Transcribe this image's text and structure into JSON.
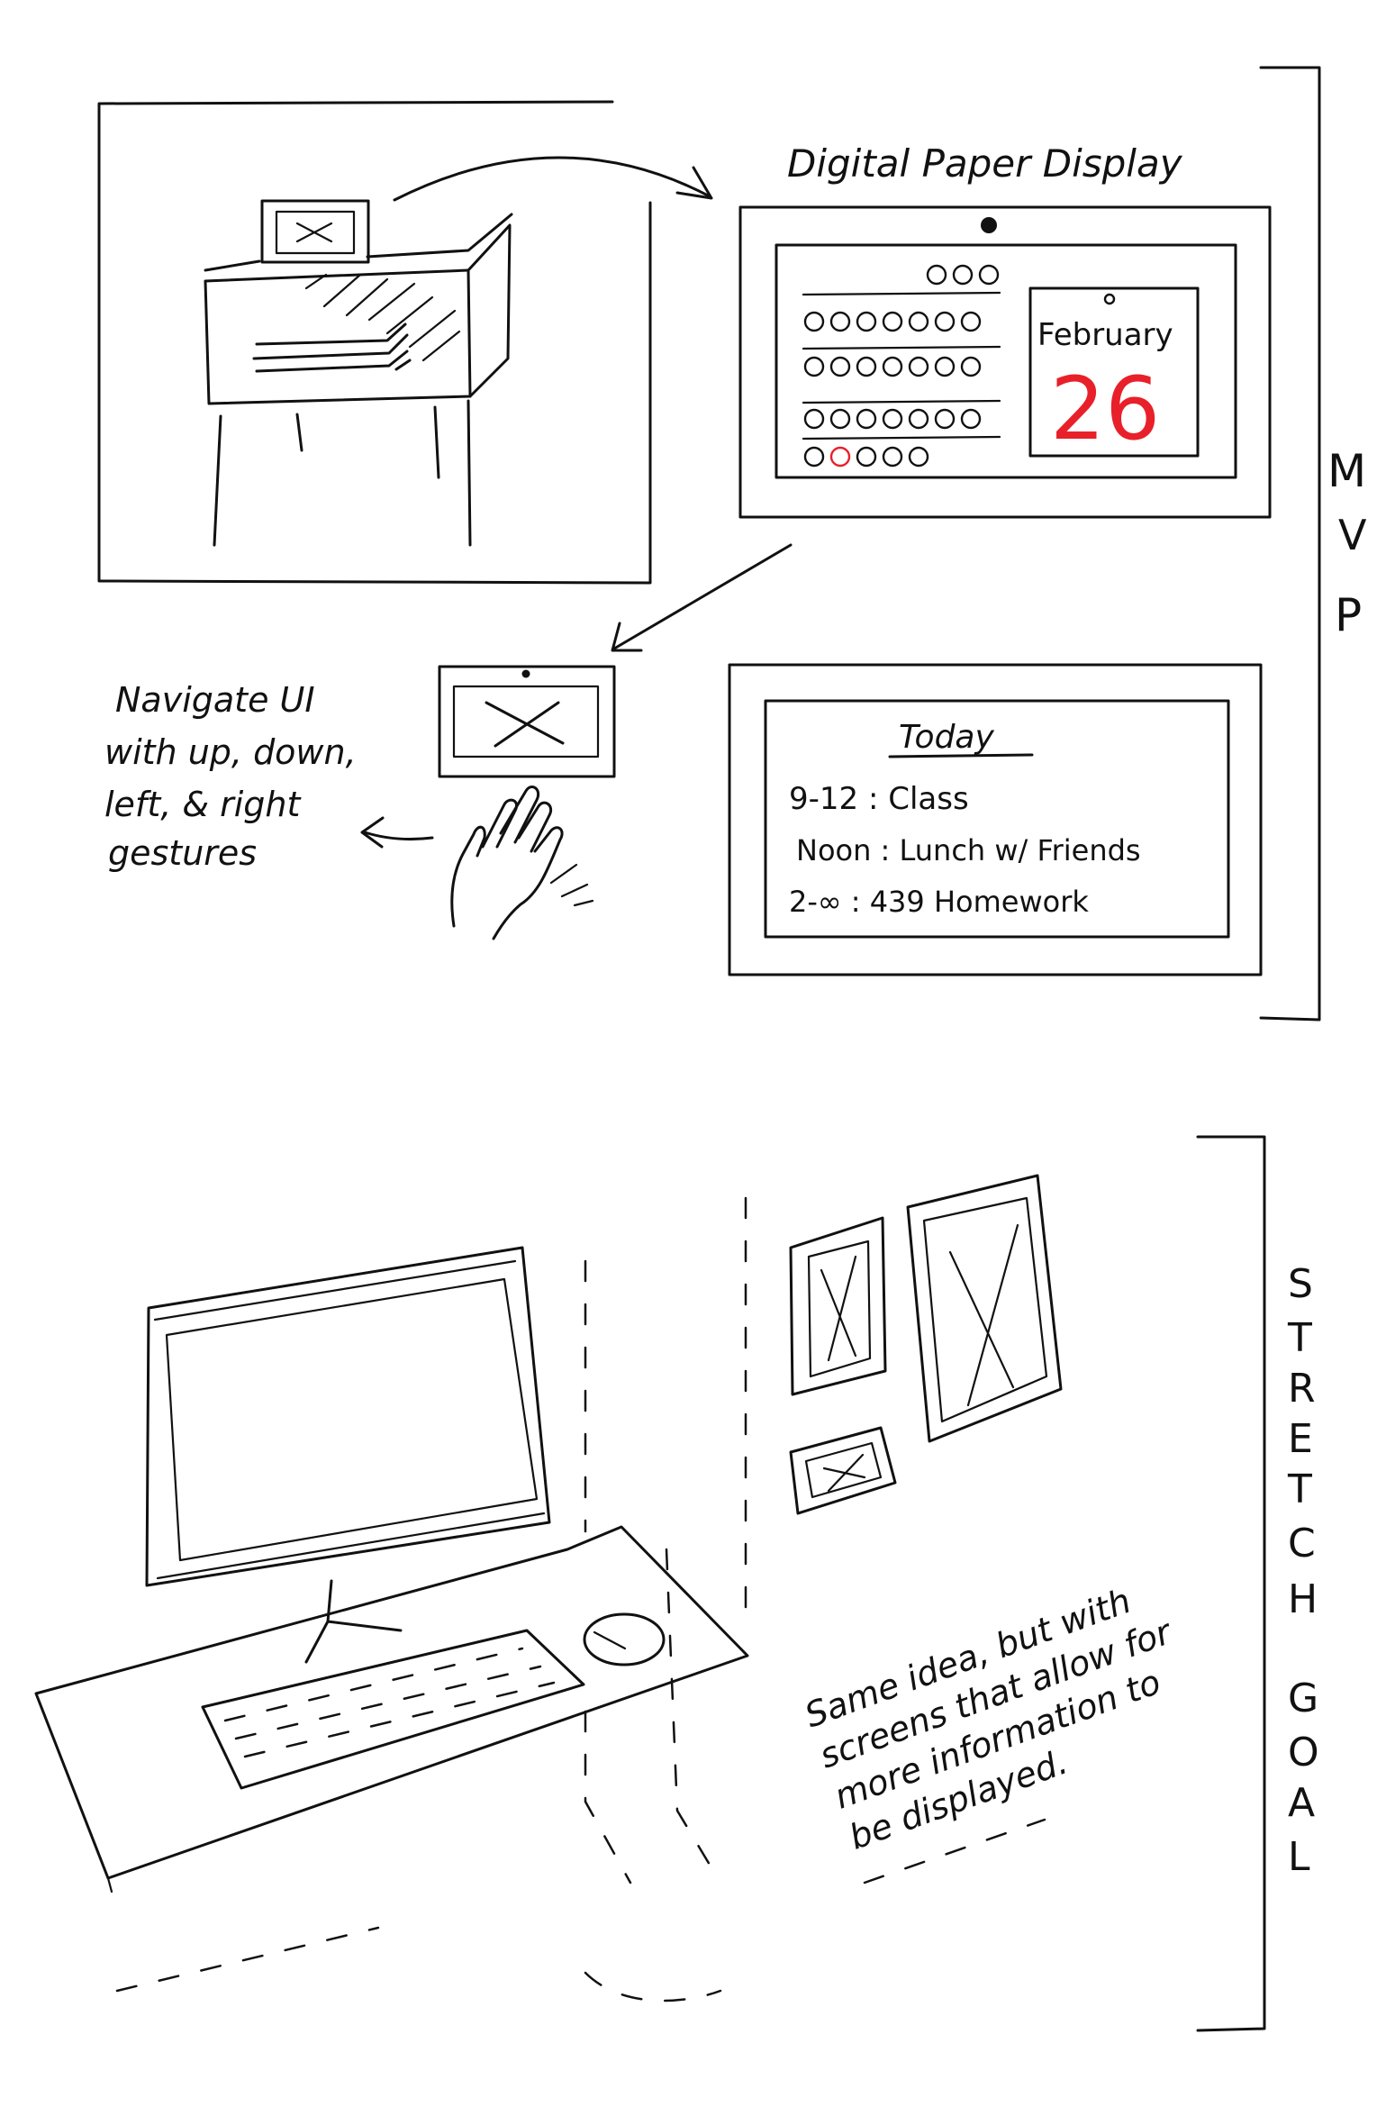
{
  "mvp": {
    "display_title": "Digital Paper Display",
    "calendar": {
      "month": "February",
      "day": "26"
    },
    "agenda": {
      "heading": "Today",
      "items": [
        "9-12 : Class",
        "Noon : Lunch w/ Friends",
        "2-∞ : 439 Homework"
      ]
    },
    "gesture_note": [
      "Navigate UI",
      "with up, down,",
      "left, & right",
      "gestures"
    ],
    "bracket_label": [
      "M",
      "V",
      "P"
    ]
  },
  "stretch": {
    "note": [
      "Same idea, but with",
      "screens that allow for",
      "more information to",
      "be displayed."
    ],
    "bracket_label": [
      "S",
      "T",
      "R",
      "E",
      "T",
      "C",
      "H",
      "G",
      "O",
      "A",
      "L"
    ]
  },
  "colors": {
    "ink": "#111111",
    "highlight": "#e8202a"
  },
  "icons": [
    "hand-wave-icon",
    "left-arrow-icon",
    "curved-arrow-icon",
    "placeholder-x-icon"
  ]
}
